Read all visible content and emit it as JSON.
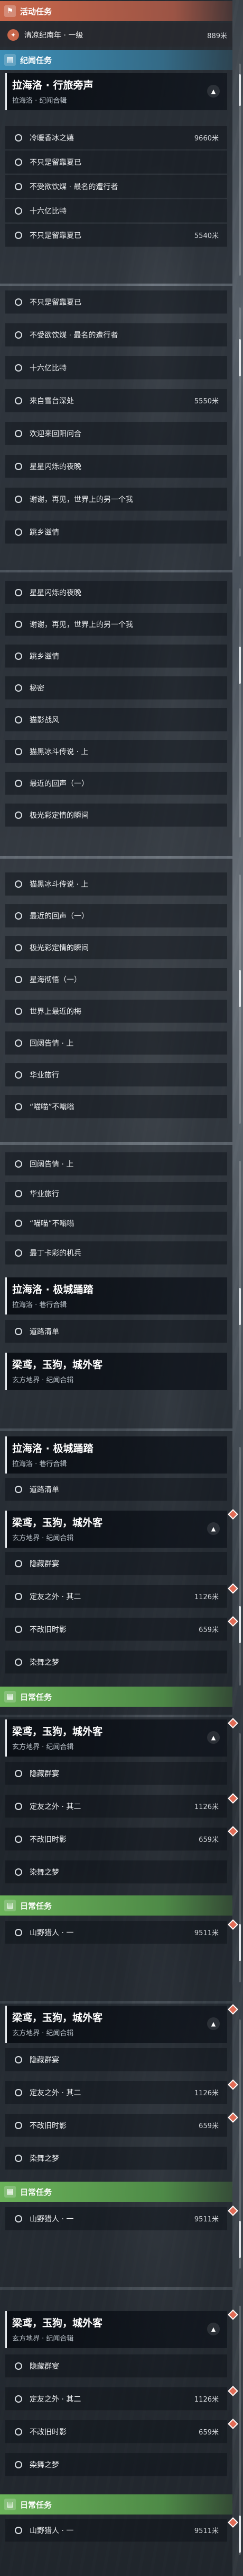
{
  "event_header": {
    "title": "活动任务",
    "icon": "flag-icon"
  },
  "event_quest": {
    "label": "清凉纪南年 · 一级",
    "distance": "889米"
  },
  "region_header": {
    "title": "纪闻任务",
    "icon": "book-icon"
  },
  "quest_lhl": {
    "title": "拉海洛 · 行旅旁声",
    "subtitle": "拉海洛 · 纪闻合辑"
  },
  "steps": {
    "s01": "冷暖香冰之嬉",
    "s02": "不只是留靠夏已",
    "s03": "不受欲饮煤 · 最名的遭行者",
    "s04": "十六亿比特",
    "s05": "不只是留靠夏已",
    "s06": "不受欲饮煤 · 最名的遭行者",
    "s07": "十六亿比特",
    "s08": "来自雪台深处",
    "s09": "欢迎来回阳问合",
    "s10": "星星闪烁的夜晚",
    "s11": "谢谢，再见，世界上的另一个我",
    "s12": "跳乡滋情",
    "s13": "星星闪烁的夜晚",
    "s14": "谢谢，再见，世界上的另一个我",
    "s15": "跳乡滋情",
    "s16": "秘密",
    "s17": "猫影战风",
    "s18": "猫黑冰斗传说 · 上",
    "s19": "最近的回声（一）",
    "s20": "极光彩定情的瞬间",
    "s21": "猫黑冰斗传说 · 上",
    "s22": "最近的回声（一）",
    "s23": "极光彩定情的瞬间",
    "s24": "星海彻悟（一）",
    "s25": "世界上最近的梅",
    "s26": "回阔告情 · 上",
    "s27": "华业旅行",
    "s28": "“喵喵”不嗡嗡",
    "s29": "回阔告情 · 上",
    "s30": "华业旅行",
    "s31": "“喵喵”不嗡嗡",
    "s32": "最丁卡彩的机兵",
    "s33": "道路清单",
    "s34": "道路清单",
    "s35": "隐藏群宴",
    "s36": "定友之外 · 其二",
    "s37": "不改旧时影",
    "s38": "染舞之梦",
    "s39": "山野猎人 · 一",
    "s40": "隐藏群宴",
    "s41": "定友之外 · 其二",
    "s42": "不改旧时影",
    "s43": "染舞之梦",
    "s44": "山野猎人 · 一",
    "s45": "隐藏群宴",
    "s46": "定友之外 · 其二",
    "s47": "不改旧时影",
    "s48": "染舞之梦",
    "s49": "山野猎人 · 一",
    "s50": "隐藏群宴",
    "s51": "定友之外 · 其二",
    "s52": "不改旧时影",
    "s53": "染舞之梦",
    "s54": "山野猎人 · 一"
  },
  "distances": {
    "d1": "9660米",
    "d2": "5540米",
    "d3": "5550米",
    "d4": "1126米",
    "d5": "659米",
    "d6": "1126米",
    "d7": "659米",
    "d8": "9511米",
    "d9": "1126米",
    "d10": "659米",
    "d11": "9511米",
    "d12": "1126米",
    "d13": "659米",
    "d14": "9511米"
  },
  "quest_lhl_jj": {
    "title": "拉海洛 · 极城踊踏",
    "subtitle": "拉海洛 · 巷行合辑"
  },
  "quest_lyy": {
    "title": "梁鸢，玉狗，城外客",
    "subtitle": "玄方地界 · 纪闻合辑"
  },
  "daily_header": {
    "title": "日常任务",
    "icon": "book-icon"
  },
  "colors": {
    "event": "#c9674b",
    "region": "#3d8fb7",
    "daily": "#6bb35a",
    "marker": "#e06b55"
  }
}
